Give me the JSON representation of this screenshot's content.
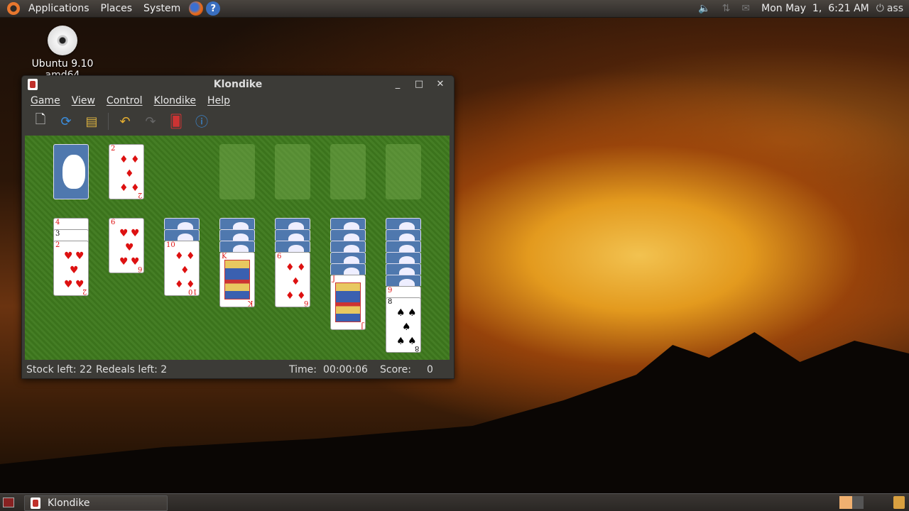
{
  "top_panel": {
    "menus": [
      "Applications",
      "Places",
      "System"
    ],
    "clock": "Mon May  1,  6:21 AM",
    "user": "ass"
  },
  "desktop": {
    "icon_label": "Ubuntu 9.10 amd64"
  },
  "window": {
    "title": "Klondike",
    "menus": [
      "Game",
      "View",
      "Control",
      "Klondike",
      "Help"
    ],
    "status": {
      "stock": "Stock left: 22",
      "redeals": "Redeals left: 2",
      "time_label": "Time:",
      "time_value": "00:00:06",
      "score_label": "Score:",
      "score_value": "0"
    }
  },
  "game": {
    "waste_card": {
      "rank": "2",
      "suit": "♦",
      "color": "red"
    },
    "tableau": [
      {
        "hidden": 0,
        "up": [
          {
            "rank": "4",
            "suit": "♠",
            "color": "red"
          },
          {
            "rank": "3",
            "suit": "♠",
            "color": "blk"
          },
          {
            "rank": "2",
            "suit": "♥",
            "color": "red"
          }
        ]
      },
      {
        "hidden": 0,
        "up": [
          {
            "rank": "6",
            "suit": "♥",
            "color": "red"
          }
        ]
      },
      {
        "hidden": 2,
        "up": [
          {
            "rank": "10",
            "suit": "♦",
            "color": "red"
          }
        ]
      },
      {
        "hidden": 3,
        "up": [
          {
            "rank": "K",
            "suit": "♦",
            "color": "red"
          }
        ]
      },
      {
        "hidden": 3,
        "up": [
          {
            "rank": "6",
            "suit": "♦",
            "color": "red"
          }
        ]
      },
      {
        "hidden": 5,
        "up": [
          {
            "rank": "J",
            "suit": "♥",
            "color": "red"
          }
        ]
      },
      {
        "hidden": 6,
        "up": [
          {
            "rank": "9",
            "suit": "♥",
            "color": "red"
          },
          {
            "rank": "8",
            "suit": "♠",
            "color": "blk"
          }
        ]
      }
    ]
  },
  "taskbar": {
    "task": "Klondike"
  }
}
